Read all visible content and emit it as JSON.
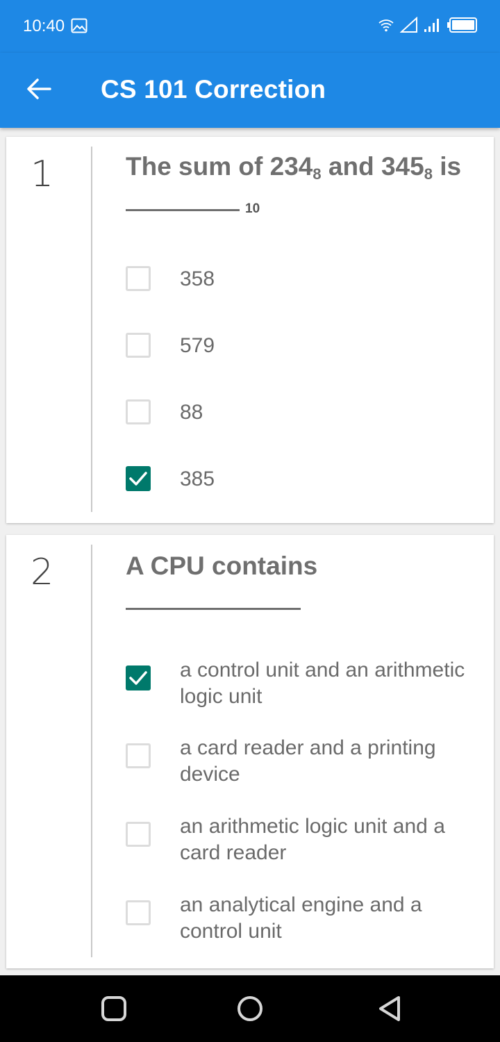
{
  "status_bar": {
    "time": "10:40",
    "icons": [
      "gallery-icon",
      "wifi-icon",
      "signal-outline-icon",
      "signal-bars-icon",
      "battery-icon"
    ]
  },
  "app_bar": {
    "title": "CS 101 Correction",
    "back_icon": "arrow-left-icon",
    "background": "#1e88e5"
  },
  "questions": [
    {
      "number": "1",
      "text_before": "The sum of 234",
      "sub1": "8",
      "text_mid": " and 345",
      "sub2": "8",
      "text_after": " is",
      "blank_subscript": "10",
      "options": [
        {
          "label": "358",
          "checked": false
        },
        {
          "label": "579",
          "checked": false
        },
        {
          "label": "88",
          "checked": false
        },
        {
          "label": "385",
          "checked": true
        }
      ]
    },
    {
      "number": "2",
      "text": "A CPU contains",
      "options": [
        {
          "label": "a control unit and an arithmetic logic unit",
          "checked": true
        },
        {
          "label": "a card reader and a printing device",
          "checked": false
        },
        {
          "label": "an arithmetic logic unit and a card reader",
          "checked": false
        },
        {
          "label": "an analytical engine and a control unit",
          "checked": false
        }
      ]
    }
  ],
  "check_color": "#00796b",
  "nav_bar": {
    "buttons": [
      "recents-icon",
      "home-icon",
      "back-triangle-icon"
    ]
  }
}
